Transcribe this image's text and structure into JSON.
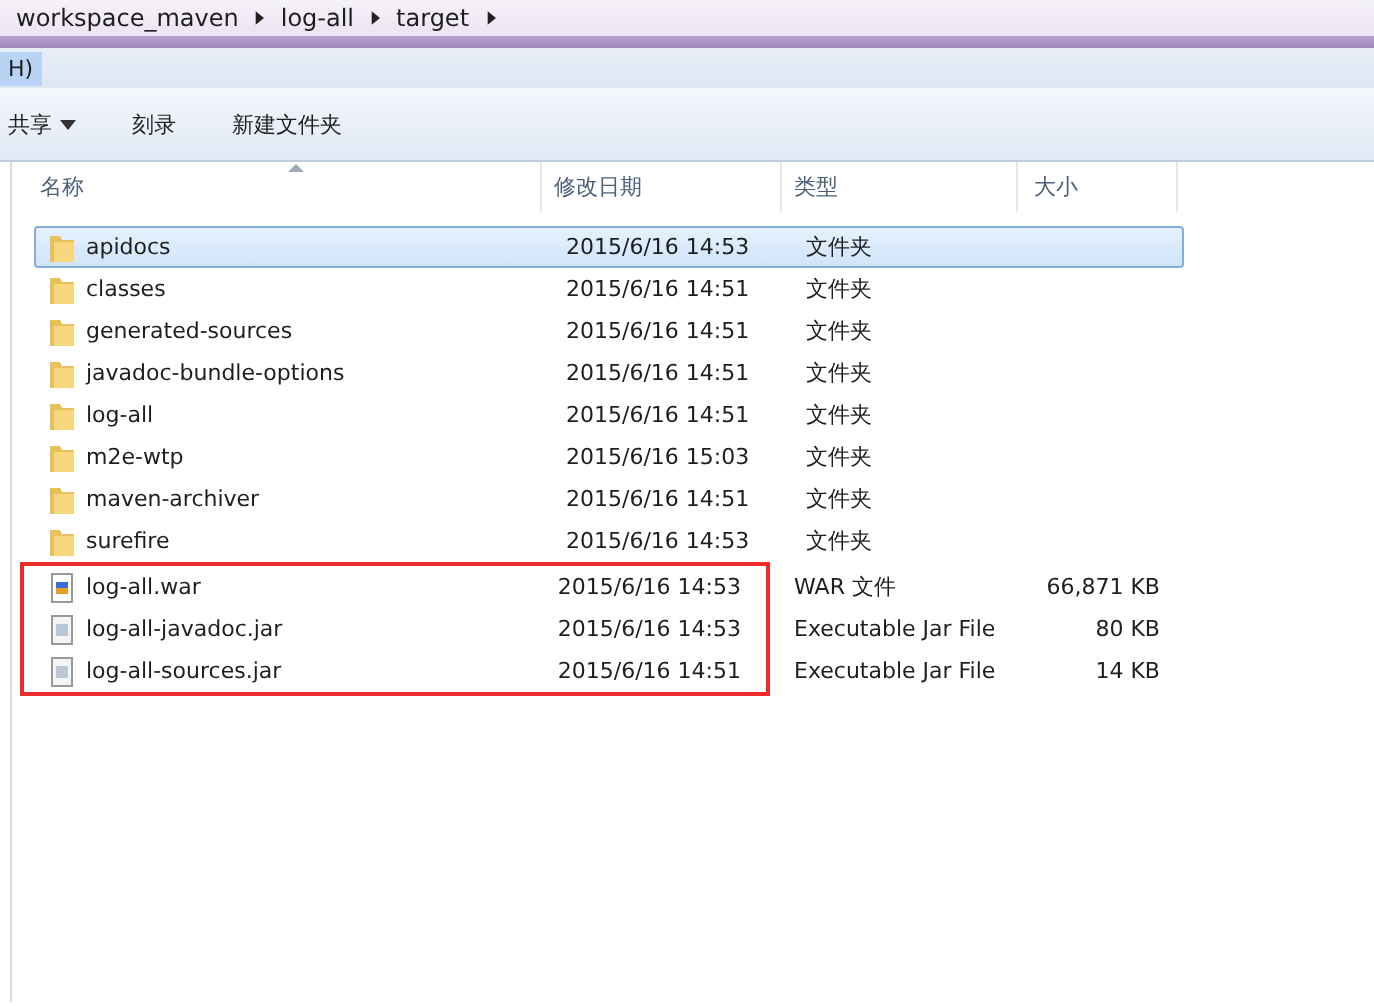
{
  "breadcrumb": [
    "workspace_maven",
    "log-all",
    "target"
  ],
  "menu": {
    "label": "H)",
    "selected": true
  },
  "toolbar": [
    {
      "label": "共享",
      "dropdown": true
    },
    {
      "label": "刻录",
      "dropdown": false
    },
    {
      "label": "新建文件夹",
      "dropdown": false
    }
  ],
  "columns": [
    "名称",
    "修改日期",
    "类型",
    "大小"
  ],
  "rows": [
    {
      "kind": "folder",
      "name": "apidocs",
      "date": "2015/6/16 14:53",
      "type": "文件夹",
      "selected": true,
      "highlighted": false
    },
    {
      "kind": "folder",
      "name": "classes",
      "date": "2015/6/16 14:51",
      "type": "文件夹",
      "selected": false,
      "highlighted": false
    },
    {
      "kind": "folder",
      "name": "generated-sources",
      "date": "2015/6/16 14:51",
      "type": "文件夹",
      "selected": false,
      "highlighted": false
    },
    {
      "kind": "folder",
      "name": "javadoc-bundle-options",
      "date": "2015/6/16 14:51",
      "type": "文件夹",
      "selected": false,
      "highlighted": false
    },
    {
      "kind": "folder",
      "name": "log-all",
      "date": "2015/6/16 14:51",
      "type": "文件夹",
      "selected": false,
      "highlighted": false
    },
    {
      "kind": "folder",
      "name": "m2e-wtp",
      "date": "2015/6/16 15:03",
      "type": "文件夹",
      "selected": false,
      "highlighted": false
    },
    {
      "kind": "folder",
      "name": "maven-archiver",
      "date": "2015/6/16 14:51",
      "type": "文件夹",
      "selected": false,
      "highlighted": false
    },
    {
      "kind": "folder",
      "name": "surefire",
      "date": "2015/6/16 14:53",
      "type": "文件夹",
      "selected": false,
      "highlighted": false
    },
    {
      "kind": "war",
      "name": "log-all.war",
      "date": "2015/6/16 14:53",
      "type": "WAR 文件",
      "size": "66,871 KB",
      "selected": false,
      "highlighted": true
    },
    {
      "kind": "jar",
      "name": "log-all-javadoc.jar",
      "date": "2015/6/16 14:53",
      "type": "Executable Jar File",
      "size": "80 KB",
      "selected": false,
      "highlighted": true
    },
    {
      "kind": "jar",
      "name": "log-all-sources.jar",
      "date": "2015/6/16 14:51",
      "type": "Executable Jar File",
      "size": "14 KB",
      "selected": false,
      "highlighted": true
    }
  ]
}
